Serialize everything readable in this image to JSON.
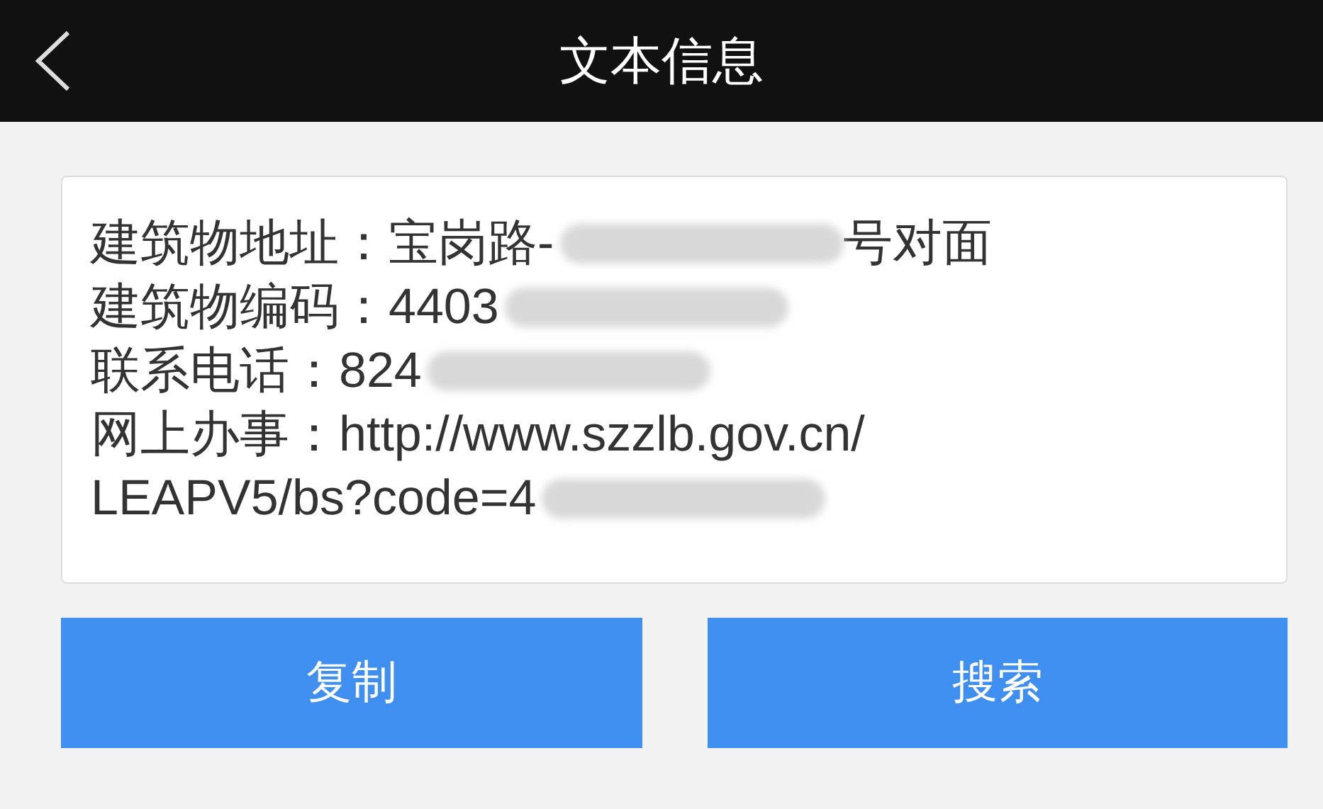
{
  "header": {
    "title": "文本信息"
  },
  "info_lines": [
    {
      "segments": [
        {
          "kind": "text",
          "text": "建筑物地址：宝岗路-"
        },
        {
          "kind": "redaction"
        },
        {
          "kind": "text",
          "text": "号对面"
        }
      ]
    },
    {
      "segments": [
        {
          "kind": "text",
          "text": "建筑物编码：4403"
        },
        {
          "kind": "redaction"
        }
      ]
    },
    {
      "segments": [
        {
          "kind": "text",
          "text": "联系电话：824"
        },
        {
          "kind": "redaction"
        }
      ]
    },
    {
      "segments": [
        {
          "kind": "text",
          "text": "网上办事：http://www.szzlb.gov.cn/"
        }
      ]
    },
    {
      "segments": [
        {
          "kind": "text",
          "text": "LEAPV5/bs?code=4"
        },
        {
          "kind": "redaction"
        }
      ]
    }
  ],
  "buttons": [
    "复制",
    "搜索"
  ]
}
